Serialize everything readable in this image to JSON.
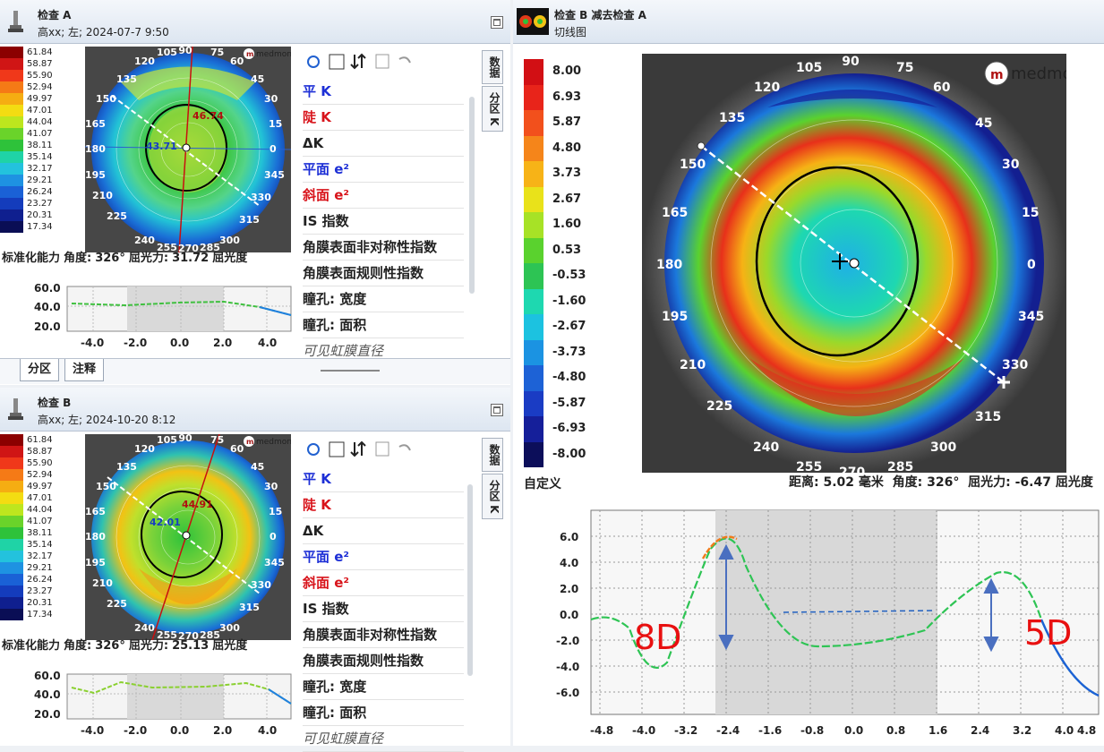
{
  "exam_a": {
    "title": "检查 A",
    "subtitle": "高xx; 左; 2024-07-7 9:50",
    "status": {
      "label": "标准化能力",
      "angle_label": "角度:",
      "angle": "326°",
      "power_label": "屈光力:",
      "power": "31.72",
      "unit": "屈光度"
    },
    "flat_k": "43.71",
    "steep_k": "46.74",
    "mini_yticks": [
      "60.0",
      "40.0",
      "20.0"
    ],
    "mini_xticks": [
      "-4.0",
      "-2.0",
      "0.0",
      "2.0",
      "4.0"
    ]
  },
  "exam_b": {
    "title": "检查 B",
    "subtitle": "高xx; 左; 2024-10-20 8:12",
    "status": {
      "label": "标准化能力",
      "angle_label": "角度:",
      "angle": "326°",
      "power_label": "屈光力:",
      "power": "25.13",
      "unit": "屈光度"
    },
    "flat_k": "42.01",
    "steep_k": "44.91",
    "mini_yticks": [
      "60.0",
      "40.0",
      "20.0"
    ],
    "mini_xticks": [
      "-4.0",
      "-2.0",
      "0.0",
      "2.0",
      "4.0"
    ]
  },
  "diff": {
    "title": "检查 B 减去检查 A",
    "subtitle": "切线图",
    "legend_label": "自定义",
    "status": {
      "dist_label": "距离:",
      "dist": "5.02",
      "dist_unit": "毫米",
      "angle_label": "角度:",
      "angle": "326°",
      "power_label": "屈光力:",
      "power": "-6.47",
      "unit": "屈光度"
    },
    "annotations": {
      "left": "8D",
      "right": "5D"
    }
  },
  "legend_a": {
    "values": [
      "61.84",
      "58.87",
      "55.90",
      "52.94",
      "49.97",
      "47.01",
      "44.04",
      "41.07",
      "38.11",
      "35.14",
      "32.17",
      "29.21",
      "26.24",
      "23.27",
      "20.31",
      "17.34"
    ],
    "colors": [
      "#8b0000",
      "#d01515",
      "#f0381a",
      "#f57a16",
      "#f5ad12",
      "#f3dc12",
      "#bde61e",
      "#6ad32a",
      "#2ec23a",
      "#1fd3a6",
      "#23c2dd",
      "#1e92e2",
      "#1a61d6",
      "#143cbc",
      "#0f1f8f",
      "#0a0e55"
    ]
  },
  "legend_diff": {
    "values": [
      "8.00",
      "6.93",
      "5.87",
      "4.80",
      "3.73",
      "2.67",
      "1.60",
      "0.53",
      "-0.53",
      "-1.60",
      "-2.67",
      "-3.73",
      "-4.80",
      "-5.87",
      "-6.93",
      "-8.00"
    ],
    "colors": [
      "#d20f14",
      "#e8241a",
      "#f2501c",
      "#f5851a",
      "#f7b317",
      "#e9e21a",
      "#a7e226",
      "#5ad22e",
      "#2dc454",
      "#1ed8b0",
      "#1cc2e0",
      "#1b93e2",
      "#1d62d6",
      "#1a3cc4",
      "#151f9a",
      "#0c0e5a"
    ]
  },
  "k_toolbar": {
    "refresh": "refresh-icon",
    "report": "report-icon",
    "sort": "sort-icon",
    "save": "save-icon",
    "undo": "undo-icon"
  },
  "k_list": [
    {
      "label": "平 K",
      "color": "blue"
    },
    {
      "label": "陡 K",
      "color": "red"
    },
    {
      "label": "ΔK",
      "color": "plain"
    },
    {
      "label": "平面 e²",
      "color": "blue"
    },
    {
      "label": "斜面 e²",
      "color": "red"
    },
    {
      "label": "IS 指数",
      "color": "plain"
    },
    {
      "label": "角膜表面非对称性指数",
      "color": "plain"
    },
    {
      "label": "角膜表面规则性指数",
      "color": "plain"
    },
    {
      "label": "瞳孔: 宽度",
      "color": "plain"
    },
    {
      "label": "瞳孔: 面积",
      "color": "plain"
    },
    {
      "label": "可见虹膜直径",
      "color": "ital"
    }
  ],
  "side_tabs": [
    "数据",
    "分区 K"
  ],
  "bottom_tabs": [
    "分区",
    "注释"
  ],
  "map_angles": [
    "90",
    "75",
    "60",
    "45",
    "30",
    "15",
    "0",
    "345",
    "330",
    "315",
    "300",
    "285",
    "270",
    "255",
    "240",
    "225",
    "210",
    "195",
    "180",
    "165",
    "150",
    "135",
    "120",
    "105"
  ],
  "diff_chart": {
    "yticks": [
      "6.0",
      "4.0",
      "2.0",
      "0.0",
      "-2.0",
      "-4.0",
      "-6.0"
    ],
    "xticks": [
      "-4.8",
      "-4.0",
      "-3.2",
      "-2.4",
      "-1.6",
      "-0.8",
      "0.0",
      "0.8",
      "1.6",
      "2.4",
      "3.2",
      "4.0",
      "4.8"
    ]
  },
  "brand": "medmont"
}
